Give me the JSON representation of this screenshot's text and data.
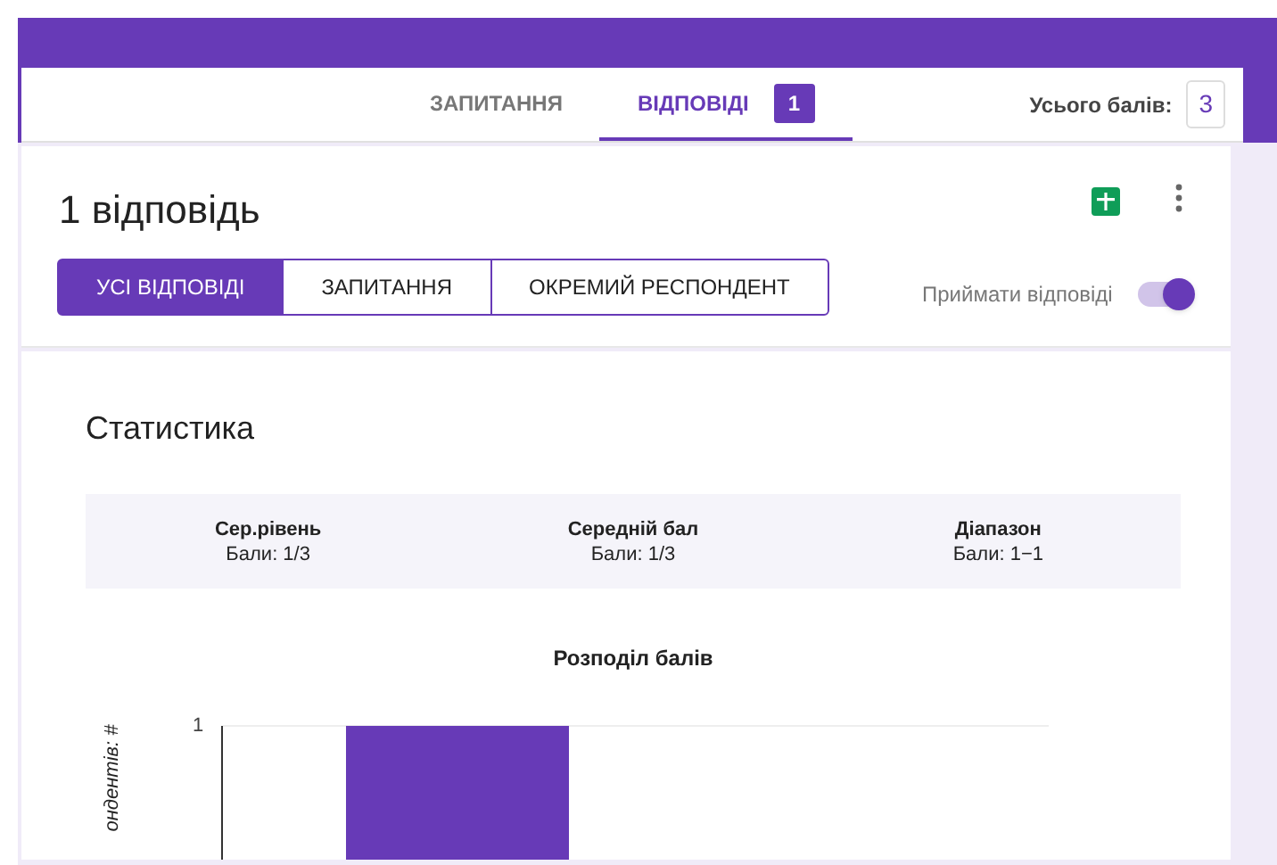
{
  "tabs": [
    {
      "label": "ЗАПИТАННЯ",
      "selected": false
    },
    {
      "label": "ВІДПОВІДІ",
      "selected": true,
      "badge": "1"
    }
  ],
  "total_points": {
    "label": "Усього балів:",
    "value": "3"
  },
  "responses": {
    "title": "1 відповідь",
    "views": [
      {
        "label": "УСІ ВІДПОВІДІ",
        "selected": true
      },
      {
        "label": "ЗАПИТАННЯ",
        "selected": false
      },
      {
        "label": "ОКРЕМИЙ РЕСПОНДЕНТ",
        "selected": false
      }
    ],
    "accepting": {
      "label": "Приймати відповіді",
      "on": true
    }
  },
  "statistics": {
    "title": "Статистика",
    "stats": [
      {
        "label": "Сер.рівень",
        "value": "Бали: 1/3"
      },
      {
        "label": "Середній бал",
        "value": "Бали: 1/3"
      },
      {
        "label": "Діапазон",
        "value": "Бали: 1−1"
      }
    ],
    "chart": {
      "title": "Розподіл балів",
      "ytick": "1",
      "ylabel": "ондентів: #"
    }
  }
}
